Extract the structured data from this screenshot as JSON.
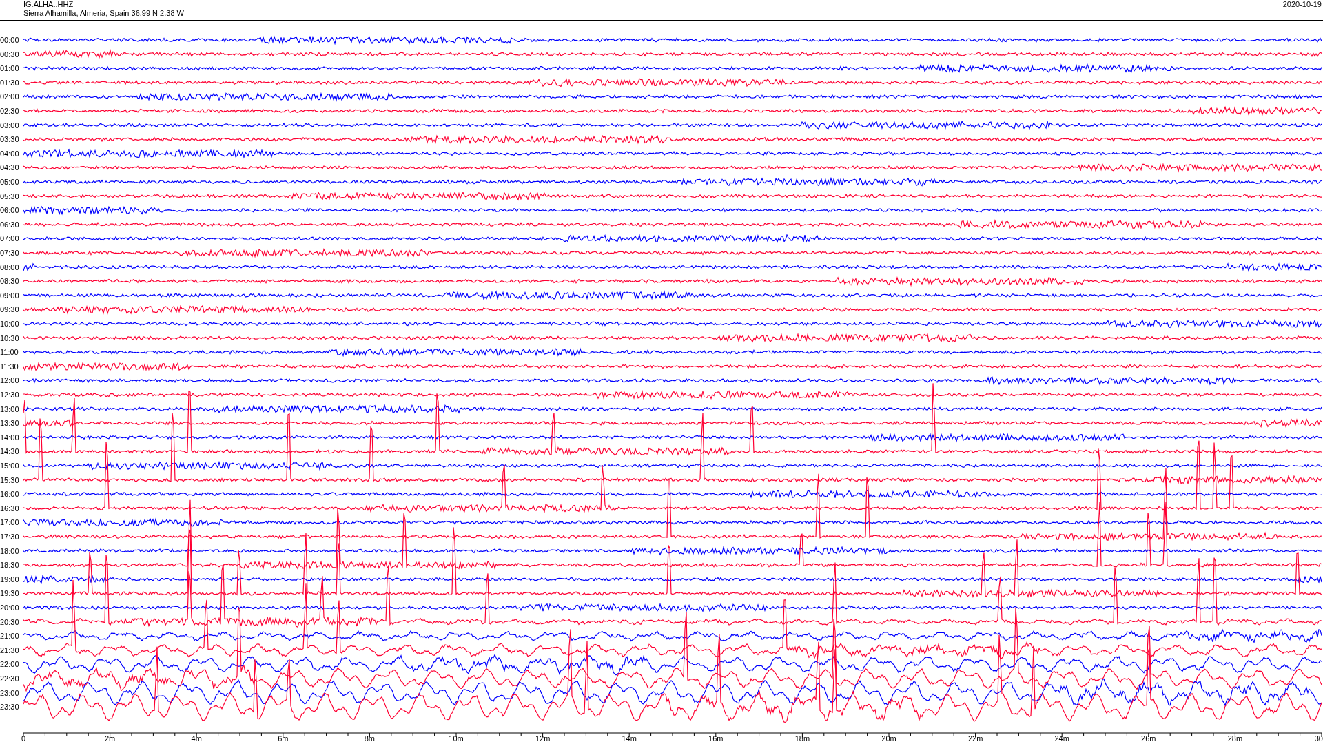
{
  "header": {
    "station_code": "IG.ALHA..HHZ",
    "location": "Sierra Alhamilla, Almeria, Spain  36.99 N 2.38 W",
    "date": "2020-10-19"
  },
  "rows": [
    {
      "time": "00:00",
      "color": "#0000ff"
    },
    {
      "time": "00:30",
      "color": "#ff0033"
    },
    {
      "time": "01:00",
      "color": "#0000ff"
    },
    {
      "time": "01:30",
      "color": "#ff0033"
    },
    {
      "time": "02:00",
      "color": "#0000ff"
    },
    {
      "time": "02:30",
      "color": "#ff0033"
    },
    {
      "time": "03:00",
      "color": "#0000ff"
    },
    {
      "time": "03:30",
      "color": "#ff0033"
    },
    {
      "time": "04:00",
      "color": "#0000ff"
    },
    {
      "time": "04:30",
      "color": "#ff0033"
    },
    {
      "time": "05:00",
      "color": "#0000ff"
    },
    {
      "time": "05:30",
      "color": "#ff0033"
    },
    {
      "time": "06:00",
      "color": "#0000ff"
    },
    {
      "time": "06:30",
      "color": "#ff0033"
    },
    {
      "time": "07:00",
      "color": "#0000ff"
    },
    {
      "time": "07:30",
      "color": "#ff0033"
    },
    {
      "time": "08:00",
      "color": "#0000ff"
    },
    {
      "time": "08:30",
      "color": "#ff0033"
    },
    {
      "time": "09:00",
      "color": "#0000ff"
    },
    {
      "time": "09:30",
      "color": "#ff0033"
    },
    {
      "time": "10:00",
      "color": "#0000ff"
    },
    {
      "time": "10:30",
      "color": "#ff0033"
    },
    {
      "time": "11:00",
      "color": "#0000ff"
    },
    {
      "time": "11:30",
      "color": "#ff0033"
    },
    {
      "time": "12:00",
      "color": "#0000ff"
    },
    {
      "time": "12:30",
      "color": "#ff0033"
    },
    {
      "time": "13:00",
      "color": "#0000ff"
    },
    {
      "time": "13:30",
      "color": "#ff0033"
    },
    {
      "time": "14:00",
      "color": "#0000ff"
    },
    {
      "time": "14:30",
      "color": "#ff0033"
    },
    {
      "time": "15:00",
      "color": "#0000ff"
    },
    {
      "time": "15:30",
      "color": "#ff0033"
    },
    {
      "time": "16:00",
      "color": "#0000ff"
    },
    {
      "time": "16:30",
      "color": "#ff0033"
    },
    {
      "time": "17:00",
      "color": "#0000ff"
    },
    {
      "time": "17:30",
      "color": "#ff0033"
    },
    {
      "time": "18:00",
      "color": "#0000ff"
    },
    {
      "time": "18:30",
      "color": "#ff0033"
    },
    {
      "time": "19:00",
      "color": "#0000ff"
    },
    {
      "time": "19:30",
      "color": "#ff0033"
    },
    {
      "time": "20:00",
      "color": "#0000ff"
    },
    {
      "time": "20:30",
      "color": "#ff0033"
    },
    {
      "time": "21:00",
      "color": "#0000ff"
    },
    {
      "time": "21:30",
      "color": "#ff0033"
    },
    {
      "time": "22:00",
      "color": "#0000ff"
    },
    {
      "time": "22:30",
      "color": "#ff0033"
    },
    {
      "time": "23:00",
      "color": "#0000ff"
    },
    {
      "time": "23:30",
      "color": "#ff0033"
    }
  ],
  "x_axis": {
    "labels": [
      "0",
      "2m",
      "4m",
      "6m",
      "8m",
      "10m",
      "12m",
      "14m",
      "16m",
      "18m",
      "20m",
      "22m",
      "24m",
      "26m",
      "28m",
      "30"
    ]
  }
}
